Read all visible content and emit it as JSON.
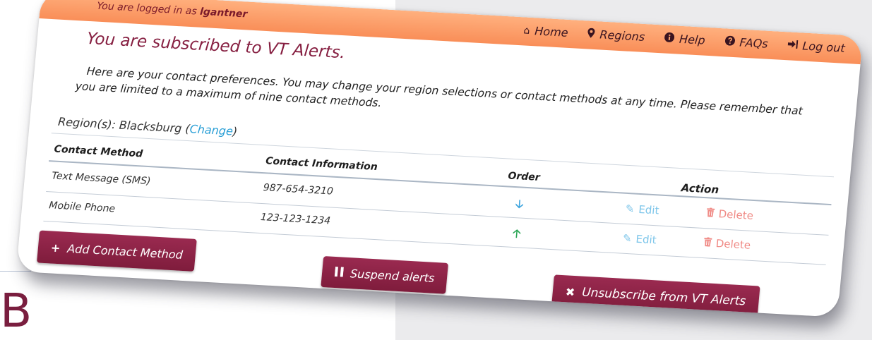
{
  "header": {
    "login_prefix": "You are logged in as ",
    "username": "lgantner",
    "nav": [
      {
        "label": "Home",
        "icon": "home-icon"
      },
      {
        "label": "Regions",
        "icon": "map-marker-icon"
      },
      {
        "label": "Help",
        "icon": "info-circle-icon"
      },
      {
        "label": "FAQs",
        "icon": "question-circle-icon"
      },
      {
        "label": "Log out",
        "icon": "sign-out-icon"
      }
    ]
  },
  "page": {
    "title": "You are subscribed to VT Alerts.",
    "intro": "Here are your contact preferences. You may change your region selections or contact methods at any time. Please remember that you are limited to a maximum of nine contact methods.",
    "region_prefix": "Region(s): Blacksburg (",
    "region_link": "Change",
    "region_suffix": ")"
  },
  "table": {
    "headers": {
      "method": "Contact Method",
      "info": "Contact Information",
      "order": "Order",
      "action": "Action"
    },
    "rows": [
      {
        "method": "Text Message (SMS)",
        "info": "987-654-3210",
        "order": "down",
        "edit": "Edit",
        "delete": "Delete"
      },
      {
        "method": "Mobile Phone",
        "info": "123-123-1234",
        "order": "up",
        "edit": "Edit",
        "delete": "Delete"
      }
    ]
  },
  "buttons": {
    "add": "Add Contact Method",
    "suspend": "Suspend alerts",
    "unsubscribe": "Unsubscribe from VT Alerts"
  },
  "background": {
    "letter": "B"
  },
  "colors": {
    "maroon": "#861f41",
    "orange_bar": "#f98e58",
    "link_blue": "#2a9fd6",
    "edit_blue": "#7ec6ea",
    "delete_red": "#f08b86",
    "order_up_green": "#2aa555"
  }
}
